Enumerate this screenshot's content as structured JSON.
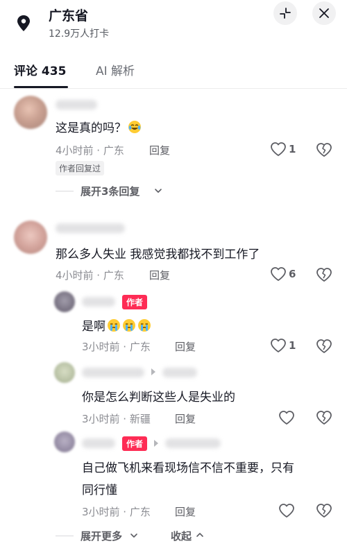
{
  "header": {
    "title": "广东省",
    "subtitle": "12.9万人打卡",
    "pin_icon": "location-pin-icon",
    "collapse_icon": "collapse-icon",
    "close_icon": "close-icon"
  },
  "tabs": [
    {
      "label": "评论 435",
      "active": true
    },
    {
      "label": "AI 解析",
      "active": false
    }
  ],
  "comments": {
    "c1": {
      "text": "这是真的吗？",
      "emoji": "crying-laughing-emoji",
      "meta": "4小时前 · 广东",
      "reply": "回复",
      "likes": "1",
      "badge": "作者回复过",
      "expand": "展开3条回复"
    },
    "c2": {
      "text": "那么多人失业 我感觉我都找不到工作了",
      "meta": "4小时前 · 广东",
      "reply": "回复",
      "likes": "6"
    },
    "r1": {
      "author_badge": "作者",
      "text": "是啊",
      "emoji": "crying-emoji",
      "meta": "3小时前 · 广东",
      "reply": "回复",
      "likes": "1"
    },
    "r2": {
      "text": "你是怎么判断这些人是失业的",
      "meta": "3小时前 · 新疆",
      "reply": "回复"
    },
    "r3": {
      "author_badge": "作者",
      "text_line1": "自己做飞机来看现场信不信不重要，只有",
      "text_line2": "同行懂",
      "meta": "3小时前 · 广东",
      "reply": "回复"
    }
  },
  "footer": {
    "expand_more": "展开更多",
    "collapse": "收起"
  },
  "colors": {
    "accent_red": "#fe2c55",
    "text_primary": "#161823",
    "text_secondary": "#8a8b91"
  }
}
